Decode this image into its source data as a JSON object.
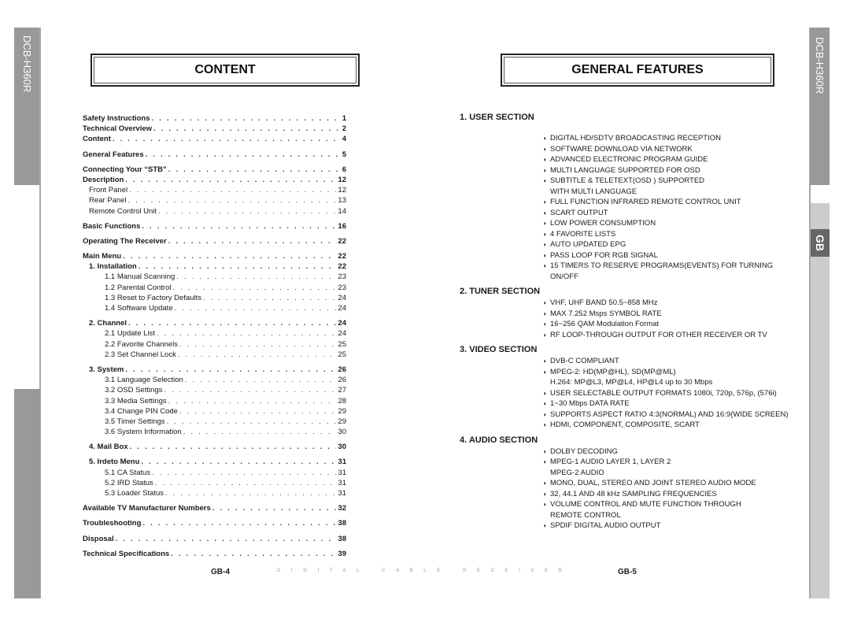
{
  "side_tabs": {
    "model_left": "DCB-H360R",
    "model_right": "DCB-H360R",
    "language": "GB"
  },
  "left_page": {
    "title": "CONTENT",
    "toc": [
      {
        "label": "Safety Instructions",
        "page": "1",
        "level": 0,
        "bold": true,
        "gap": false
      },
      {
        "label": "Technical Overview",
        "page": "2",
        "level": 0,
        "bold": true,
        "gap": false
      },
      {
        "label": "Content",
        "page": "4",
        "level": 0,
        "bold": true,
        "gap": false
      },
      {
        "label": "General Features",
        "page": "5",
        "level": 0,
        "bold": true,
        "gap": true
      },
      {
        "label": "Connecting Your “STB”",
        "page": "6",
        "level": 0,
        "bold": true,
        "gap": true
      },
      {
        "label": "Description",
        "page": "12",
        "level": 0,
        "bold": true,
        "gap": false
      },
      {
        "label": "Front Panel",
        "page": "12",
        "level": 1,
        "bold": false,
        "gap": false
      },
      {
        "label": "Rear Panel",
        "page": "13",
        "level": 1,
        "bold": false,
        "gap": false
      },
      {
        "label": "Remote Control Unit",
        "page": "14",
        "level": 1,
        "bold": false,
        "gap": false
      },
      {
        "label": "Basic Functions",
        "page": "16",
        "level": 0,
        "bold": true,
        "gap": true
      },
      {
        "label": "Operating The Receiver",
        "page": "22",
        "level": 0,
        "bold": true,
        "gap": true
      },
      {
        "label": "Main Menu",
        "page": "22",
        "level": 0,
        "bold": true,
        "gap": true
      },
      {
        "label": "1. Installation",
        "page": "22",
        "level": 1,
        "bold": true,
        "gap": false
      },
      {
        "label": "1.1  Manual Scanning",
        "page": "23",
        "level": 2,
        "bold": false,
        "gap": false
      },
      {
        "label": "1.2  Parental Control",
        "page": "23",
        "level": 2,
        "bold": false,
        "gap": false
      },
      {
        "label": "1.3  Reset to Factory Defaults",
        "page": "24",
        "level": 2,
        "bold": false,
        "gap": false
      },
      {
        "label": "1.4  Software Update",
        "page": "24",
        "level": 2,
        "bold": false,
        "gap": false
      },
      {
        "label": "2. Channel",
        "page": "24",
        "level": 1,
        "bold": true,
        "gap": true
      },
      {
        "label": "2.1  Update List",
        "page": "24",
        "level": 2,
        "bold": false,
        "gap": false
      },
      {
        "label": "2.2  Favorite Channels",
        "page": "25",
        "level": 2,
        "bold": false,
        "gap": false
      },
      {
        "label": "2.3  Set Channel Lock",
        "page": "25",
        "level": 2,
        "bold": false,
        "gap": false
      },
      {
        "label": "3. System",
        "page": "26",
        "level": 1,
        "bold": true,
        "gap": true
      },
      {
        "label": "3.1  Language Selection",
        "page": "26",
        "level": 2,
        "bold": false,
        "gap": false
      },
      {
        "label": "3.2  OSD Settings",
        "page": "27",
        "level": 2,
        "bold": false,
        "gap": false
      },
      {
        "label": "3.3  Media Settings",
        "page": "28",
        "level": 2,
        "bold": false,
        "gap": false
      },
      {
        "label": "3.4 Change PIN Code",
        "page": "29",
        "level": 2,
        "bold": false,
        "gap": false
      },
      {
        "label": "3.5  Timer Settings",
        "page": "29",
        "level": 2,
        "bold": false,
        "gap": false
      },
      {
        "label": "3.6  System Information",
        "page": "30",
        "level": 2,
        "bold": false,
        "gap": false
      },
      {
        "label": "4. Mail Box",
        "page": "30",
        "level": 1,
        "bold": true,
        "gap": true
      },
      {
        "label": "5. Irdeto Menu",
        "page": "31",
        "level": 1,
        "bold": true,
        "gap": true
      },
      {
        "label": "5.1  CA Status",
        "page": "31",
        "level": 2,
        "bold": false,
        "gap": false
      },
      {
        "label": "5.2  IRD Status",
        "page": "31",
        "level": 2,
        "bold": false,
        "gap": false
      },
      {
        "label": "5.3  Loader Status",
        "page": "31",
        "level": 2,
        "bold": false,
        "gap": false
      },
      {
        "label": "Available TV Manufacturer Numbers",
        "page": "32",
        "level": 0,
        "bold": true,
        "gap": true
      },
      {
        "label": "Troubleshooting",
        "page": "38",
        "level": 0,
        "bold": true,
        "gap": true
      },
      {
        "label": "Disposal",
        "page": "38",
        "level": 0,
        "bold": true,
        "gap": true
      },
      {
        "label": "Technical Specifications",
        "page": "39",
        "level": 0,
        "bold": true,
        "gap": true
      }
    ],
    "page_number": "GB-4"
  },
  "right_page": {
    "title": "GENERAL FEATURES",
    "sections": [
      {
        "title": "1. USER SECTION",
        "items": [
          [
            "DIGITAL HD/SDTV BROADCASTING RECEPTION"
          ],
          [
            "SOFTWARE DOWNLOAD VIA NETWORK"
          ],
          [
            "ADVANCED ELECTRONIC PROGRAM GUIDE"
          ],
          [
            "MULTI LANGUAGE SUPPORTED FOR OSD"
          ],
          [
            "SUBTITLE & TELETEXT(OSD ) SUPPORTED",
            "WITH MULTI LANGUAGE"
          ],
          [
            "FULL FUNCTION INFRARED REMOTE CONTROL UNIT"
          ],
          [
            "SCART OUTPUT"
          ],
          [
            "LOW POWER CONSUMPTION"
          ],
          [
            "4 FAVORITE LISTS"
          ],
          [
            "AUTO UPDATED EPG"
          ],
          [
            "PASS LOOP FOR RGB SIGNAL"
          ],
          [
            "15 TIMERS TO RESERVE PROGRAMS(EVENTS) FOR TURNING",
            "ON/OFF"
          ]
        ]
      },
      {
        "title": "2. TUNER SECTION",
        "items": [
          [
            "VHF, UHF BAND 50.5~858 MHz"
          ],
          [
            "MAX 7.252 Msps SYMBOL RATE"
          ],
          [
            "16~256 QAM Modulation Format"
          ],
          [
            "RF LOOP-THROUGH OUTPUT FOR OTHER RECEIVER OR TV"
          ]
        ]
      },
      {
        "title": "3. VIDEO SECTION",
        "items": [
          [
            "DVB-C COMPLIANT"
          ],
          [
            "MPEG-2: HD(MP@HL), SD(MP@ML)",
            "H.264: MP@L3, MP@L4, HP@L4 up to 30 Mbps"
          ],
          [
            "USER SELECTABLE OUTPUT FORMATS 1080i, 720p, 576p, (576i)"
          ],
          [
            "1~30 Mbps DATA RATE"
          ],
          [
            "SUPPORTS ASPECT RATIO 4:3(NORMAL) AND 16:9(WIDE SCREEN)"
          ],
          [
            "HDMI, COMPONENT,  COMPOSITE, SCART"
          ]
        ]
      },
      {
        "title": "4. AUDIO SECTION",
        "items": [
          [
            "DOLBY DECODING"
          ],
          [
            "MPEG-1 AUDIO LAYER 1, LAYER 2",
            "MPEG-2 AUDIO"
          ],
          [
            "MONO, DUAL, STEREO AND JOINT STEREO AUDIO MODE"
          ],
          [
            "32, 44.1 AND 48 kHz SAMPLING FREQUENCIES"
          ],
          [
            "VOLUME CONTROL AND MUTE FUNCTION THROUGH",
            "REMOTE CONTROL"
          ],
          [
            "SPDIF DIGITAL AUDIO OUTPUT"
          ]
        ]
      }
    ],
    "page_number": "GB-5"
  },
  "footer": {
    "center_text": "DIGITAL CABLE RECEIVER"
  },
  "icons": {
    "bullet": "◗"
  }
}
